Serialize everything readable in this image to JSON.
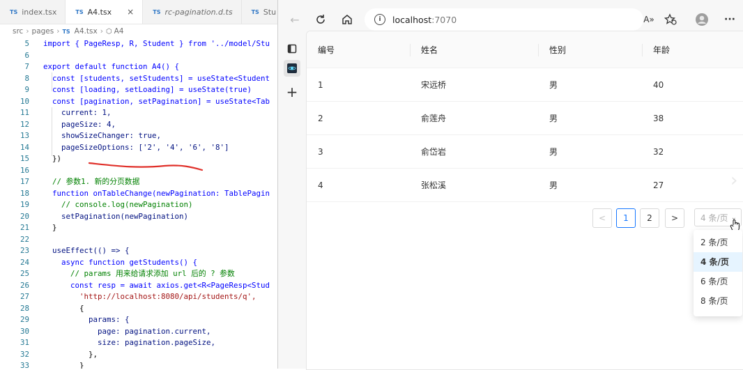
{
  "editor": {
    "tabs": [
      {
        "label": "index.tsx",
        "type": "TS"
      },
      {
        "label": "A4.tsx",
        "type": "TS",
        "close": "×"
      },
      {
        "label": "rc-pagination.d.ts",
        "type": "TS"
      },
      {
        "label": "Stu",
        "type": "TS"
      }
    ],
    "breadcrumb": [
      "src",
      "pages",
      "A4.tsx",
      "A4"
    ],
    "lines": [
      {
        "n": "5",
        "text": "import { PageResp, R, Student } from '../model/Stu",
        "cls": ""
      },
      {
        "n": "6",
        "text": "",
        "cls": ""
      },
      {
        "n": "7",
        "text": "export default function A4() {",
        "cls": ""
      },
      {
        "n": "8",
        "text": "  const [students, setStudents] = useState<Student",
        "cls": ""
      },
      {
        "n": "9",
        "text": "  const [loading, setLoading] = useState(true)",
        "cls": ""
      },
      {
        "n": "10",
        "text": "  const [pagination, setPagination] = useState<Tab",
        "cls": ""
      },
      {
        "n": "11",
        "text": "    current: 1,",
        "cls": "fn"
      },
      {
        "n": "12",
        "text": "    pageSize: 4,",
        "cls": "fn"
      },
      {
        "n": "13",
        "text": "    showSizeChanger: true,",
        "cls": "fn"
      },
      {
        "n": "14",
        "text": "    pageSizeOptions: ['2', '4', '6', '8']",
        "cls": "fn"
      },
      {
        "n": "15",
        "text": "  })",
        "cls": "plain"
      },
      {
        "n": "16",
        "text": "",
        "cls": ""
      },
      {
        "n": "17",
        "text": "  // 参数1. 新的分页数据",
        "cls": "cm"
      },
      {
        "n": "18",
        "text": "  function onTableChange(newPagination: TablePagin",
        "cls": ""
      },
      {
        "n": "19",
        "text": "    // console.log(newPagination)",
        "cls": "cm"
      },
      {
        "n": "20",
        "text": "    setPagination(newPagination)",
        "cls": "fn"
      },
      {
        "n": "21",
        "text": "  }",
        "cls": "plain"
      },
      {
        "n": "22",
        "text": "",
        "cls": ""
      },
      {
        "n": "23",
        "text": "  useEffect(() => {",
        "cls": "fn"
      },
      {
        "n": "24",
        "text": "    async function getStudents() {",
        "cls": ""
      },
      {
        "n": "25",
        "text": "      // params 用来给请求添加 url 后的 ? 参数",
        "cls": "cm"
      },
      {
        "n": "26",
        "text": "      const resp = await axios.get<R<PageResp<Stud",
        "cls": ""
      },
      {
        "n": "27",
        "text": "        'http://localhost:8080/api/students/q',",
        "cls": "str"
      },
      {
        "n": "28",
        "text": "        {",
        "cls": "plain"
      },
      {
        "n": "29",
        "text": "          params: {",
        "cls": "fn"
      },
      {
        "n": "30",
        "text": "            page: pagination.current,",
        "cls": "fn"
      },
      {
        "n": "31",
        "text": "            size: pagination.pageSize,",
        "cls": "fn"
      },
      {
        "n": "32",
        "text": "          },",
        "cls": "plain"
      },
      {
        "n": "33",
        "text": "        }",
        "cls": "plain"
      }
    ]
  },
  "browser": {
    "address_host": "localhost",
    "address_port": ":7070",
    "read_aloud": "A»",
    "table": {
      "headers": [
        "编号",
        "姓名",
        "性别",
        "年龄"
      ],
      "rows": [
        [
          "1",
          "宋远桥",
          "男",
          "40"
        ],
        [
          "2",
          "俞莲舟",
          "男",
          "38"
        ],
        [
          "3",
          "俞岱岩",
          "男",
          "32"
        ],
        [
          "4",
          "张松溪",
          "男",
          "27"
        ]
      ]
    },
    "pagination": {
      "prev": "<",
      "pages": [
        "1",
        "2"
      ],
      "current": "1",
      "next": ">",
      "size_selected": "4 条/页",
      "size_options": [
        "2 条/页",
        "4 条/页",
        "6 条/页",
        "8 条/页"
      ]
    }
  },
  "colors": {
    "accent": "#1677ff",
    "annotation": "#e0302a"
  }
}
